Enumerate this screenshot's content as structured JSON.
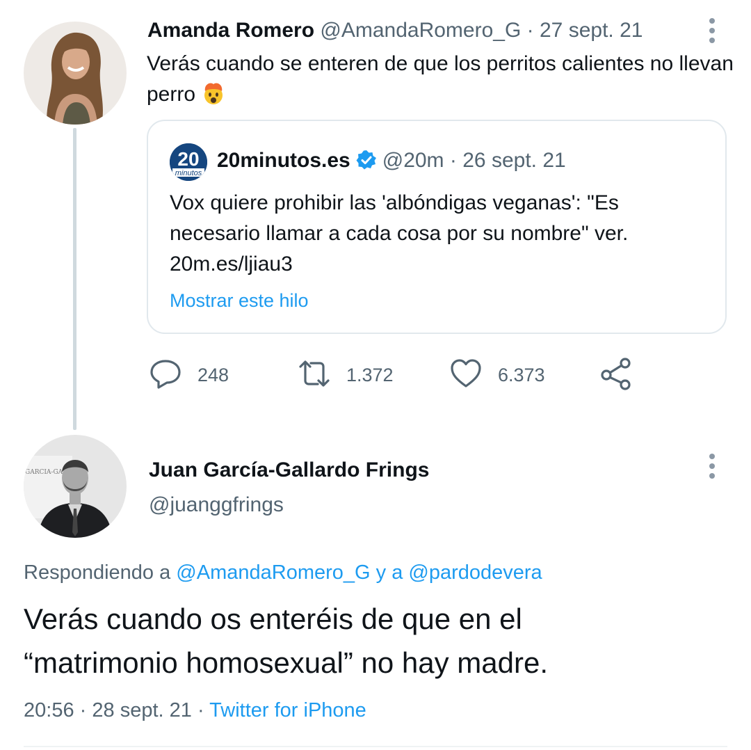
{
  "tweet": {
    "author_name": "Amanda Romero",
    "author_handle": "@AmandaRomero_G",
    "separator": "·",
    "date": "27 sept. 21",
    "text": "Verás cuando se enteren de que los perritos calientes no llevan perro",
    "emoji_icon": "exploding-head-emoji",
    "quote": {
      "logo_text_top": "20",
      "logo_text_bottom": "minutos",
      "author_name": "20minutos.es",
      "verified_icon": "verified-badge-icon",
      "author_handle": "@20m",
      "separator": "·",
      "date": "26 sept. 21",
      "text": "Vox quiere prohibir las 'albóndigas veganas': \"Es necesario llamar a cada cosa por su nombre\" ver. 20m.es/ljiau3",
      "show_thread_label": "Mostrar este hilo"
    },
    "actions": {
      "reply_count": "248",
      "retweet_count": "1.372",
      "like_count": "6.373"
    }
  },
  "reply": {
    "author_name": "Juan García-Gallardo Frings",
    "author_handle": "@juanggfrings",
    "replying_prefix": "Respondiendo a",
    "mention_1": "@AmandaRomero_G",
    "connector": "y a",
    "mention_2": "@pardodevera",
    "text_line1": "Verás cuando os enteréis de que en el",
    "text_line2": "“matrimonio homosexual” no hay madre.",
    "time": "20:56",
    "separator": "·",
    "date": "28 sept. 21",
    "source": "Twitter for iPhone"
  },
  "colors": {
    "text": "#0f1419",
    "secondary": "#536471",
    "accent": "#1d9bf0",
    "border": "#e1e8ed",
    "thread_line": "#cfd9de"
  }
}
